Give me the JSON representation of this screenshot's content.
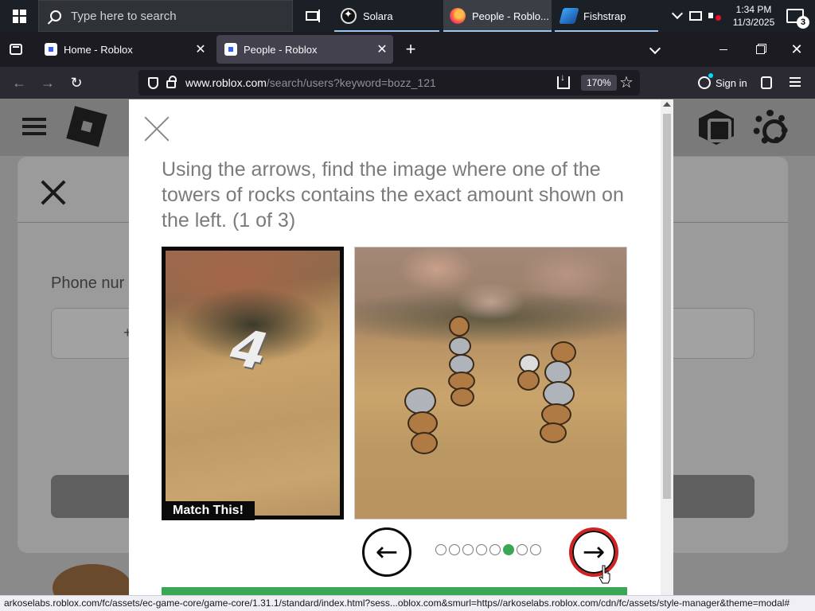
{
  "taskbar": {
    "search_placeholder": "Type here to search",
    "apps": [
      {
        "label": "Solara",
        "icon": "solara-icon"
      },
      {
        "label": "People - Roblo...",
        "icon": "firefox-icon"
      },
      {
        "label": "Fishstrap",
        "icon": "fishstrap-icon"
      }
    ],
    "clock_time": "1:34 PM",
    "clock_date": "11/3/2025",
    "notification_count": "3"
  },
  "browser": {
    "tabs": [
      {
        "title": "Home - Roblox"
      },
      {
        "title": "People - Roblox"
      }
    ],
    "url_host": "www.roblox.com",
    "url_path": "/search/users?keyword=bozz_121",
    "zoom": "170%",
    "sign_in": "Sign in"
  },
  "background_page": {
    "phone_label": "Phone nur",
    "plus": "+"
  },
  "captcha": {
    "instruction": "Using the arrows, find the image where one of the towers of rocks contains the exact amount shown on the left. (1 of 3)",
    "reference_digit": "4",
    "match_label": "Match This!",
    "prev_arrow": "←",
    "next_arrow": "→",
    "dots_total": 8,
    "dot_active_index": 5,
    "accent": "#3aa757"
  },
  "status_url": "arkoselabs.roblox.com/fc/assets/ec-game-core/game-core/1.31.1/standard/index.html?sess...oblox.com&smurl=https//arkoselabs.roblox.com/cdn/fc/assets/style-manager&theme=modal#"
}
